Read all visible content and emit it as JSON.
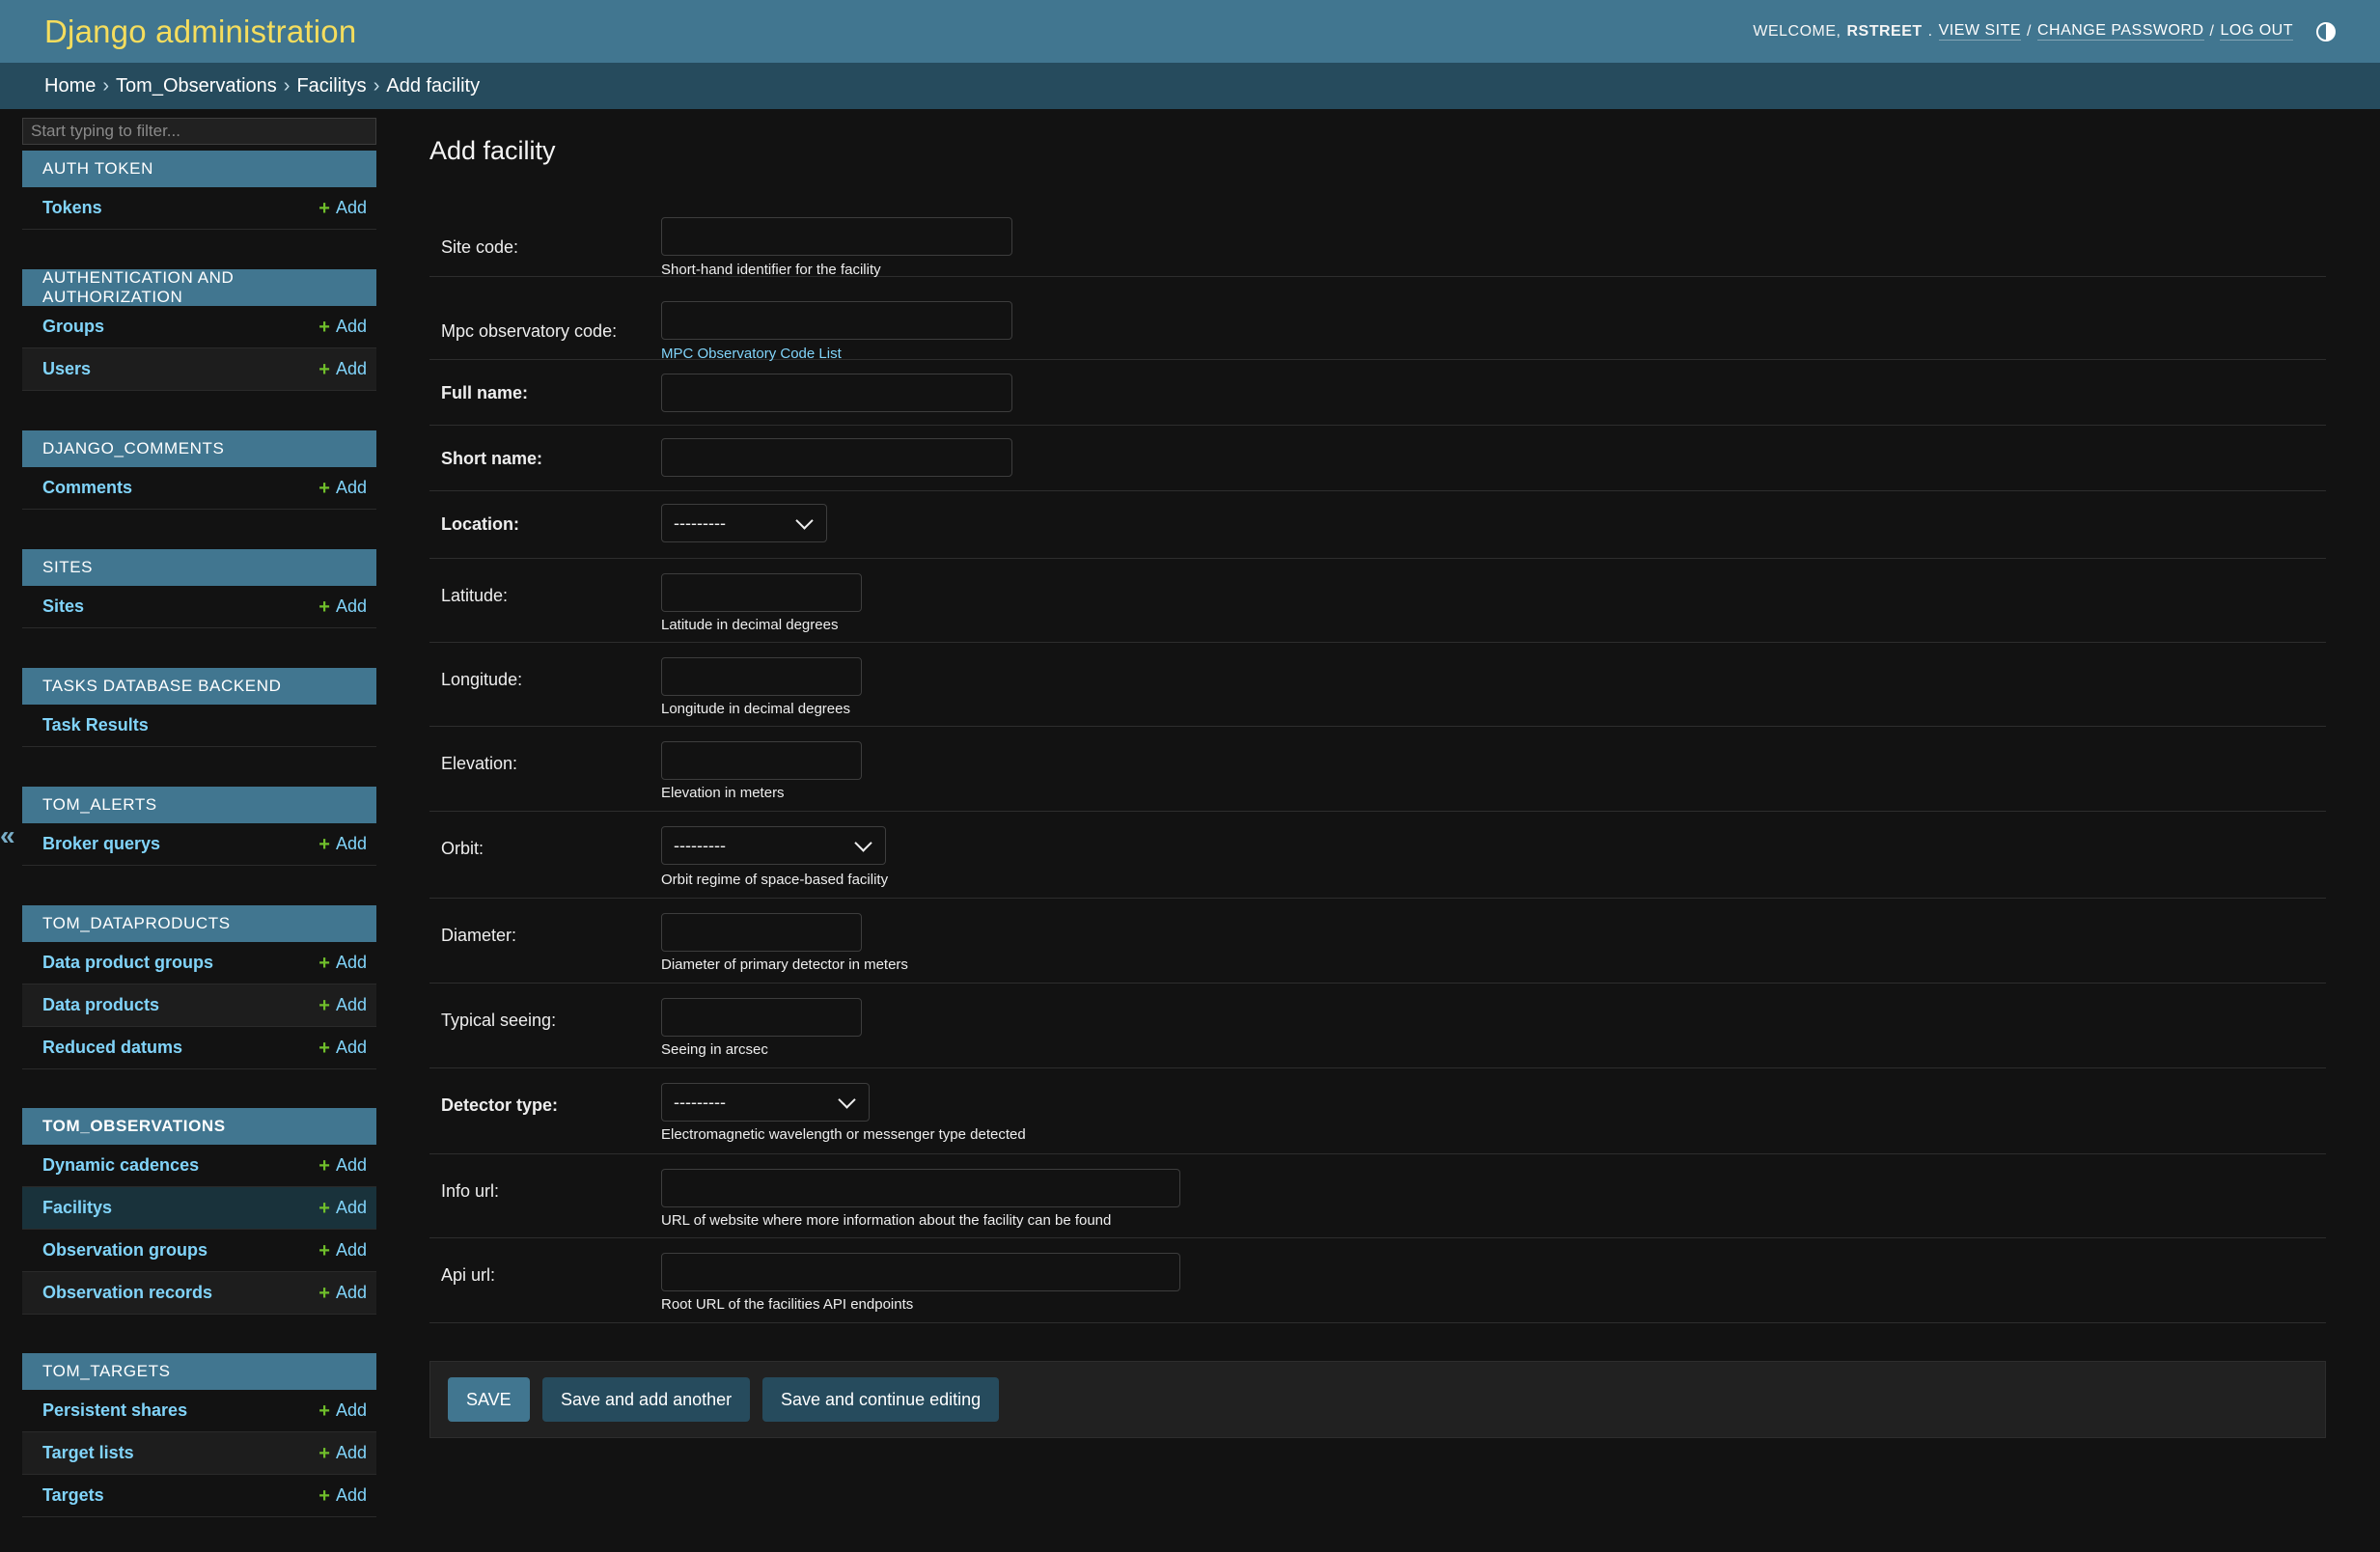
{
  "header": {
    "branding": "Django administration",
    "welcome": "Welcome,",
    "username": "rstreet",
    "view_site": "View site",
    "change_password": "Change password",
    "log_out": "Log out"
  },
  "breadcrumbs": {
    "home": "Home",
    "app": "Tom_Observations",
    "model": "Facilitys",
    "current": "Add facility",
    "separator": "›"
  },
  "sidebar": {
    "filter_placeholder": "Start typing to filter...",
    "toggle_label": "«",
    "add_label": "Add",
    "modules": [
      {
        "caption": "Auth Token",
        "models": [
          {
            "name": "Tokens",
            "add": true
          }
        ]
      },
      {
        "caption": "Authentication and Authorization",
        "models": [
          {
            "name": "Groups",
            "add": true
          },
          {
            "name": "Users",
            "add": true
          }
        ]
      },
      {
        "caption": "Django_Comments",
        "models": [
          {
            "name": "Comments",
            "add": true
          }
        ]
      },
      {
        "caption": "Sites",
        "models": [
          {
            "name": "Sites",
            "add": true
          }
        ]
      },
      {
        "caption": "Tasks Database Backend",
        "models": [
          {
            "name": "Task Results",
            "add": false
          }
        ]
      },
      {
        "caption": "Tom_Alerts",
        "models": [
          {
            "name": "Broker querys",
            "add": true
          }
        ]
      },
      {
        "caption": "Tom_Dataproducts",
        "models": [
          {
            "name": "Data product groups",
            "add": true
          },
          {
            "name": "Data products",
            "add": true
          },
          {
            "name": "Reduced datums",
            "add": true
          }
        ]
      },
      {
        "caption": "Tom_Observations",
        "models": [
          {
            "name": "Dynamic cadences",
            "add": true
          },
          {
            "name": "Facilitys",
            "add": true
          },
          {
            "name": "Observation groups",
            "add": true
          },
          {
            "name": "Observation records",
            "add": true
          }
        ]
      },
      {
        "caption": "Tom_Targets",
        "models": [
          {
            "name": "Persistent shares",
            "add": true
          },
          {
            "name": "Target lists",
            "add": true
          },
          {
            "name": "Targets",
            "add": true
          }
        ]
      }
    ]
  },
  "page_title": "Add facility",
  "form": {
    "site_code": {
      "label": "Site code:",
      "help": "Short-hand identifier for the facility",
      "value": ""
    },
    "mpc_code": {
      "label": "Mpc observatory code:",
      "help_link": "MPC Observatory Code List",
      "value": ""
    },
    "full_name": {
      "label": "Full name:",
      "value": ""
    },
    "short_name": {
      "label": "Short name:",
      "value": ""
    },
    "location": {
      "label": "Location:",
      "selected": "---------"
    },
    "latitude": {
      "label": "Latitude:",
      "help": "Latitude in decimal degrees",
      "value": ""
    },
    "longitude": {
      "label": "Longitude:",
      "help": "Longitude in decimal degrees",
      "value": ""
    },
    "elevation": {
      "label": "Elevation:",
      "help": "Elevation in meters",
      "value": ""
    },
    "orbit": {
      "label": "Orbit:",
      "selected": "---------",
      "help": "Orbit regime of space-based facility"
    },
    "diameter": {
      "label": "Diameter:",
      "help": "Diameter of primary detector in meters",
      "value": ""
    },
    "typical_seeing": {
      "label": "Typical seeing:",
      "help": "Seeing in arcsec",
      "value": ""
    },
    "detector_type": {
      "label": "Detector type:",
      "selected": "---------",
      "help": "Electromagnetic wavelength or messenger type detected"
    },
    "info_url": {
      "label": "Info url:",
      "help": "URL of website where more information about the facility can be found",
      "value": ""
    },
    "api_url": {
      "label": "Api url:",
      "help": "Root URL of the facilities API endpoints",
      "value": ""
    }
  },
  "submit": {
    "save": "Save",
    "save_add_another": "Save and add another",
    "save_continue": "Save and continue editing"
  },
  "colors": {
    "header_bg": "#417690",
    "branding": "#f5dd5d",
    "breadcrumbs_bg": "#264b5d",
    "link": "#81d4fa",
    "add_icon": "#70bf2b",
    "body_bg": "#121212"
  }
}
